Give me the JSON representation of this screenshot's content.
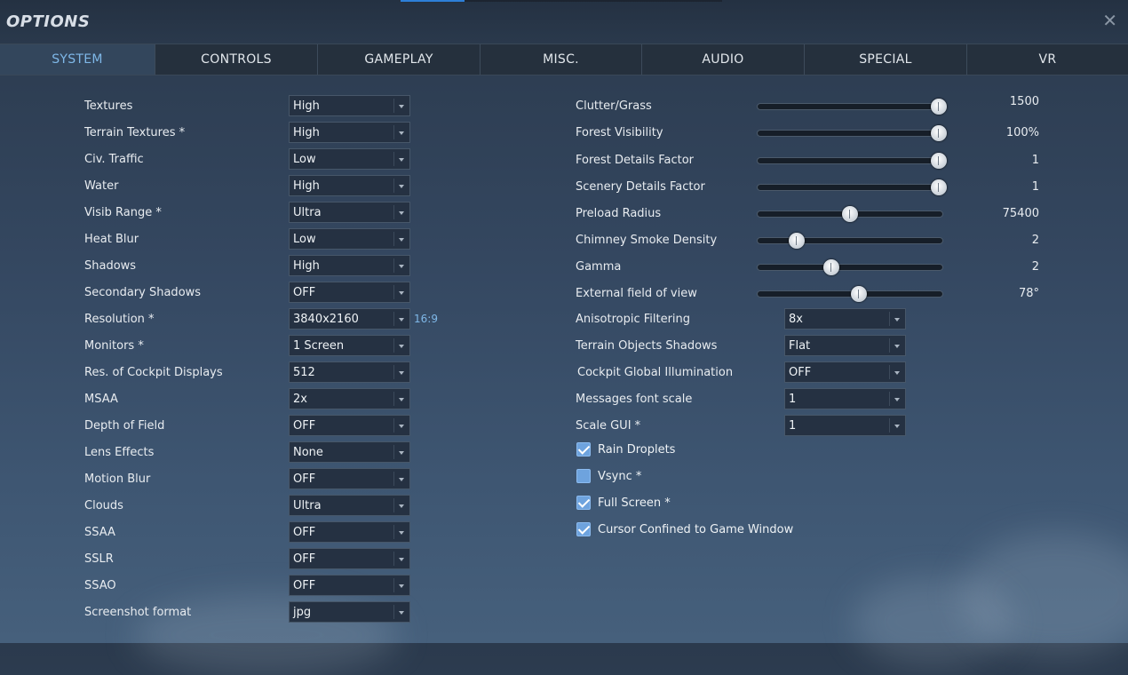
{
  "window": {
    "title": "OPTIONS"
  },
  "tabs": [
    {
      "label": "SYSTEM",
      "active": true
    },
    {
      "label": "CONTROLS",
      "active": false
    },
    {
      "label": "GAMEPLAY",
      "active": false
    },
    {
      "label": "MISC.",
      "active": false
    },
    {
      "label": "AUDIO",
      "active": false
    },
    {
      "label": "SPECIAL",
      "active": false
    },
    {
      "label": "VR",
      "active": false
    }
  ],
  "load_progress": 0.2,
  "left_settings": [
    {
      "label": "Textures",
      "value": "High"
    },
    {
      "label": "Terrain Textures *",
      "value": "High"
    },
    {
      "label": "Civ. Traffic",
      "value": "Low"
    },
    {
      "label": "Water",
      "value": "High"
    },
    {
      "label": "Visib Range *",
      "value": "Ultra"
    },
    {
      "label": "Heat Blur",
      "value": "Low"
    },
    {
      "label": "Shadows",
      "value": "High"
    },
    {
      "label": "Secondary Shadows",
      "value": "OFF"
    },
    {
      "label": "Resolution *",
      "value": "3840x2160"
    },
    {
      "label": "Monitors *",
      "value": "1 Screen"
    },
    {
      "label": "Res. of Cockpit Displays",
      "value": "512"
    },
    {
      "label": "MSAA",
      "value": "2x"
    },
    {
      "label": "Depth of Field",
      "value": "OFF"
    },
    {
      "label": "Lens Effects",
      "value": "None"
    },
    {
      "label": "Motion Blur",
      "value": "OFF"
    },
    {
      "label": "Clouds",
      "value": "Ultra"
    },
    {
      "label": "SSAA",
      "value": "OFF"
    },
    {
      "label": "SSLR",
      "value": "OFF"
    },
    {
      "label": "SSAO",
      "value": "OFF"
    },
    {
      "label": "Screenshot format",
      "value": "jpg"
    }
  ],
  "resolution_aspect": "16:9",
  "sliders": [
    {
      "label": "Clutter/Grass",
      "value": "1500",
      "fraction": 0.98
    },
    {
      "label": "Forest Visibility",
      "value": "100%",
      "fraction": 0.98
    },
    {
      "label": "Forest Details Factor",
      "value": "1",
      "fraction": 0.98
    },
    {
      "label": "Scenery Details Factor",
      "value": "1",
      "fraction": 0.98
    },
    {
      "label": "Preload Radius",
      "value": "75400",
      "fraction": 0.5
    },
    {
      "label": "Chimney Smoke Density",
      "value": "2",
      "fraction": 0.21
    },
    {
      "label": "Gamma",
      "value": "2",
      "fraction": 0.4
    },
    {
      "label": "External field of view",
      "value": "78°",
      "fraction": 0.55
    }
  ],
  "right_dropdowns": [
    {
      "label": "Anisotropic Filtering",
      "value": "8x"
    },
    {
      "label": "Terrain Objects Shadows",
      "value": "Flat"
    },
    {
      "label": "Cockpit Global Illumination",
      "value": "OFF"
    },
    {
      "label": "Messages font scale",
      "value": "1"
    },
    {
      "label": "Scale GUI *",
      "value": "1"
    }
  ],
  "checkboxes": [
    {
      "label": "Rain Droplets",
      "checked": true
    },
    {
      "label": "Vsync *",
      "checked": false
    },
    {
      "label": "Full Screen *",
      "checked": true
    },
    {
      "label": "Cursor Confined to Game Window",
      "checked": true
    }
  ],
  "colors": {
    "accent": "#7fb8e8",
    "checkbox": "#6ea3de",
    "progress": "#2d7fd8"
  }
}
